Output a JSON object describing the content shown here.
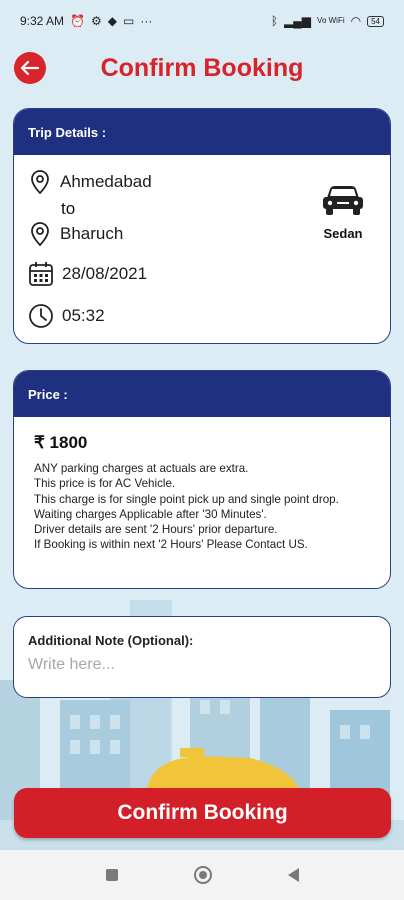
{
  "status_bar": {
    "time": "9:32 AM",
    "network": "Vo WiFi",
    "battery": "54"
  },
  "header": {
    "title": "Confirm Booking",
    "back_icon": "back-arrow-icon"
  },
  "trip": {
    "heading": "Trip Details :",
    "from": "Ahmedabad",
    "to_word": "to",
    "to": "Bharuch",
    "date": "28/08/2021",
    "time": "05:32",
    "vehicle": "Sedan"
  },
  "price": {
    "heading": "Price :",
    "amount": "₹ 1800",
    "notes": [
      "ANY parking charges at actuals are extra.",
      "This price is for AC Vehicle.",
      "This charge is for single point pick up and single point drop.",
      "Waiting charges Applicable after '30 Minutes'.",
      "Driver details are sent '2 Hours' prior departure.",
      "If Booking is within next '2 Hours' Please Contact US."
    ]
  },
  "note": {
    "label": "Additional Note (Optional):",
    "placeholder": "Write here...",
    "value": ""
  },
  "confirm_label": "Confirm Booking",
  "colors": {
    "brand_red": "#d8232a",
    "brand_blue": "#1f3080",
    "background": "#dcecf5"
  }
}
